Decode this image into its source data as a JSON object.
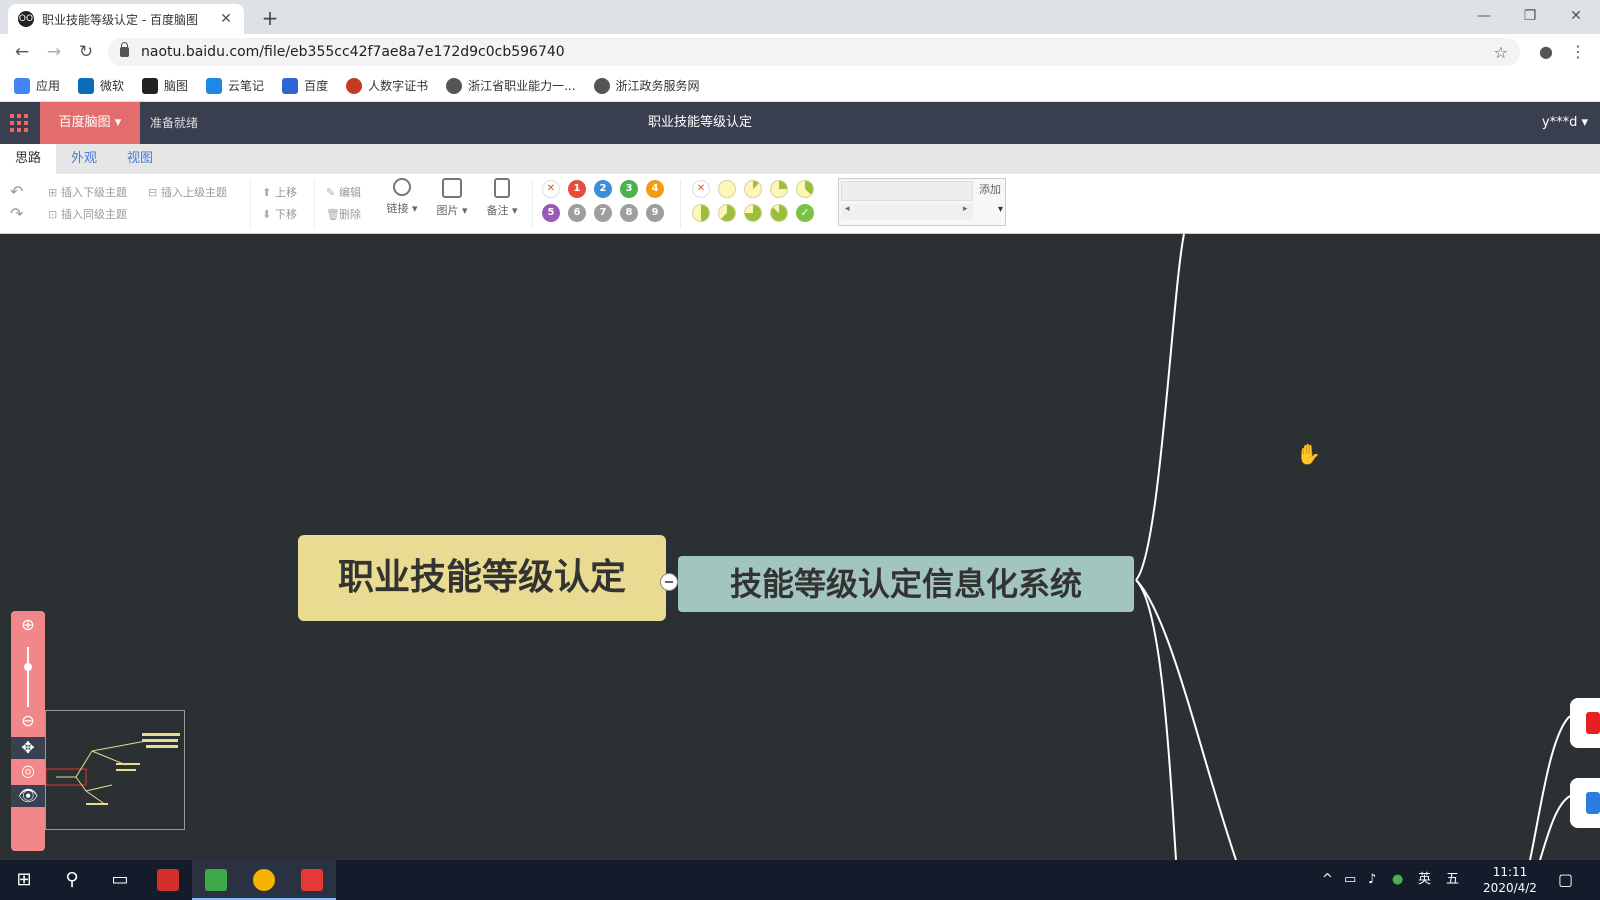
{
  "browser": {
    "tab_title": "职业技能等级认定 - 百度脑图",
    "tab_favicon_text": "OO",
    "new_tab": "+",
    "url": "naotu.baidu.com/file/eb355cc42f7ae8a7e172d9c0cb596740",
    "bookmarks": [
      {
        "label": "应用",
        "color": "#4285f4"
      },
      {
        "label": "微软",
        "color": "#0b6cbd"
      },
      {
        "label": "脑图",
        "color": "#222222"
      },
      {
        "label": "云笔记",
        "color": "#1e88e5"
      },
      {
        "label": "百度",
        "color": "#2d64d6"
      },
      {
        "label": "人数字证书",
        "color": "#c23b22"
      },
      {
        "label": "浙江省职业能力一...",
        "color": "#555555"
      },
      {
        "label": "浙江政务服务网",
        "color": "#555555"
      }
    ]
  },
  "app": {
    "brand": "百度脑图",
    "status": "准备就绪",
    "doc_title": "职业技能等级认定",
    "user": "y***d",
    "tabs": [
      "思路",
      "外观",
      "视图"
    ]
  },
  "toolbar": {
    "insert_child": "插入下级主题",
    "insert_parent": "插入上级主题",
    "insert_sibling": "插入同级主题",
    "move_up": "上移",
    "move_down": "下移",
    "edit": "编辑",
    "delete": "删除",
    "link": "链接",
    "image": "图片",
    "note": "备注",
    "resource_add": "添加",
    "priorities": [
      {
        "label": "1",
        "color": "#e74c3c"
      },
      {
        "label": "2",
        "color": "#3b8fd9"
      },
      {
        "label": "3",
        "color": "#4caf50"
      },
      {
        "label": "4",
        "color": "#f39c12"
      },
      {
        "label": "5",
        "color": "#9b59b6"
      },
      {
        "label": "6",
        "color": "#9e9e9e"
      },
      {
        "label": "7",
        "color": "#9e9e9e"
      },
      {
        "label": "8",
        "color": "#9e9e9e"
      },
      {
        "label": "9",
        "color": "#9e9e9e"
      }
    ]
  },
  "mindmap": {
    "root": "职业技能等级认定",
    "child": "技能等级认定信息化系统"
  },
  "taskbar": {
    "ime": "英",
    "ime_mode": "五",
    "time": "11:11",
    "date": "2020/4/2"
  },
  "colors": {
    "header_bg": "#393f4f",
    "brand_bg": "#e36c6c",
    "canvas_bg": "#2b3032",
    "root_bg": "#e9dc92",
    "child_bg": "#a3c5c0"
  }
}
